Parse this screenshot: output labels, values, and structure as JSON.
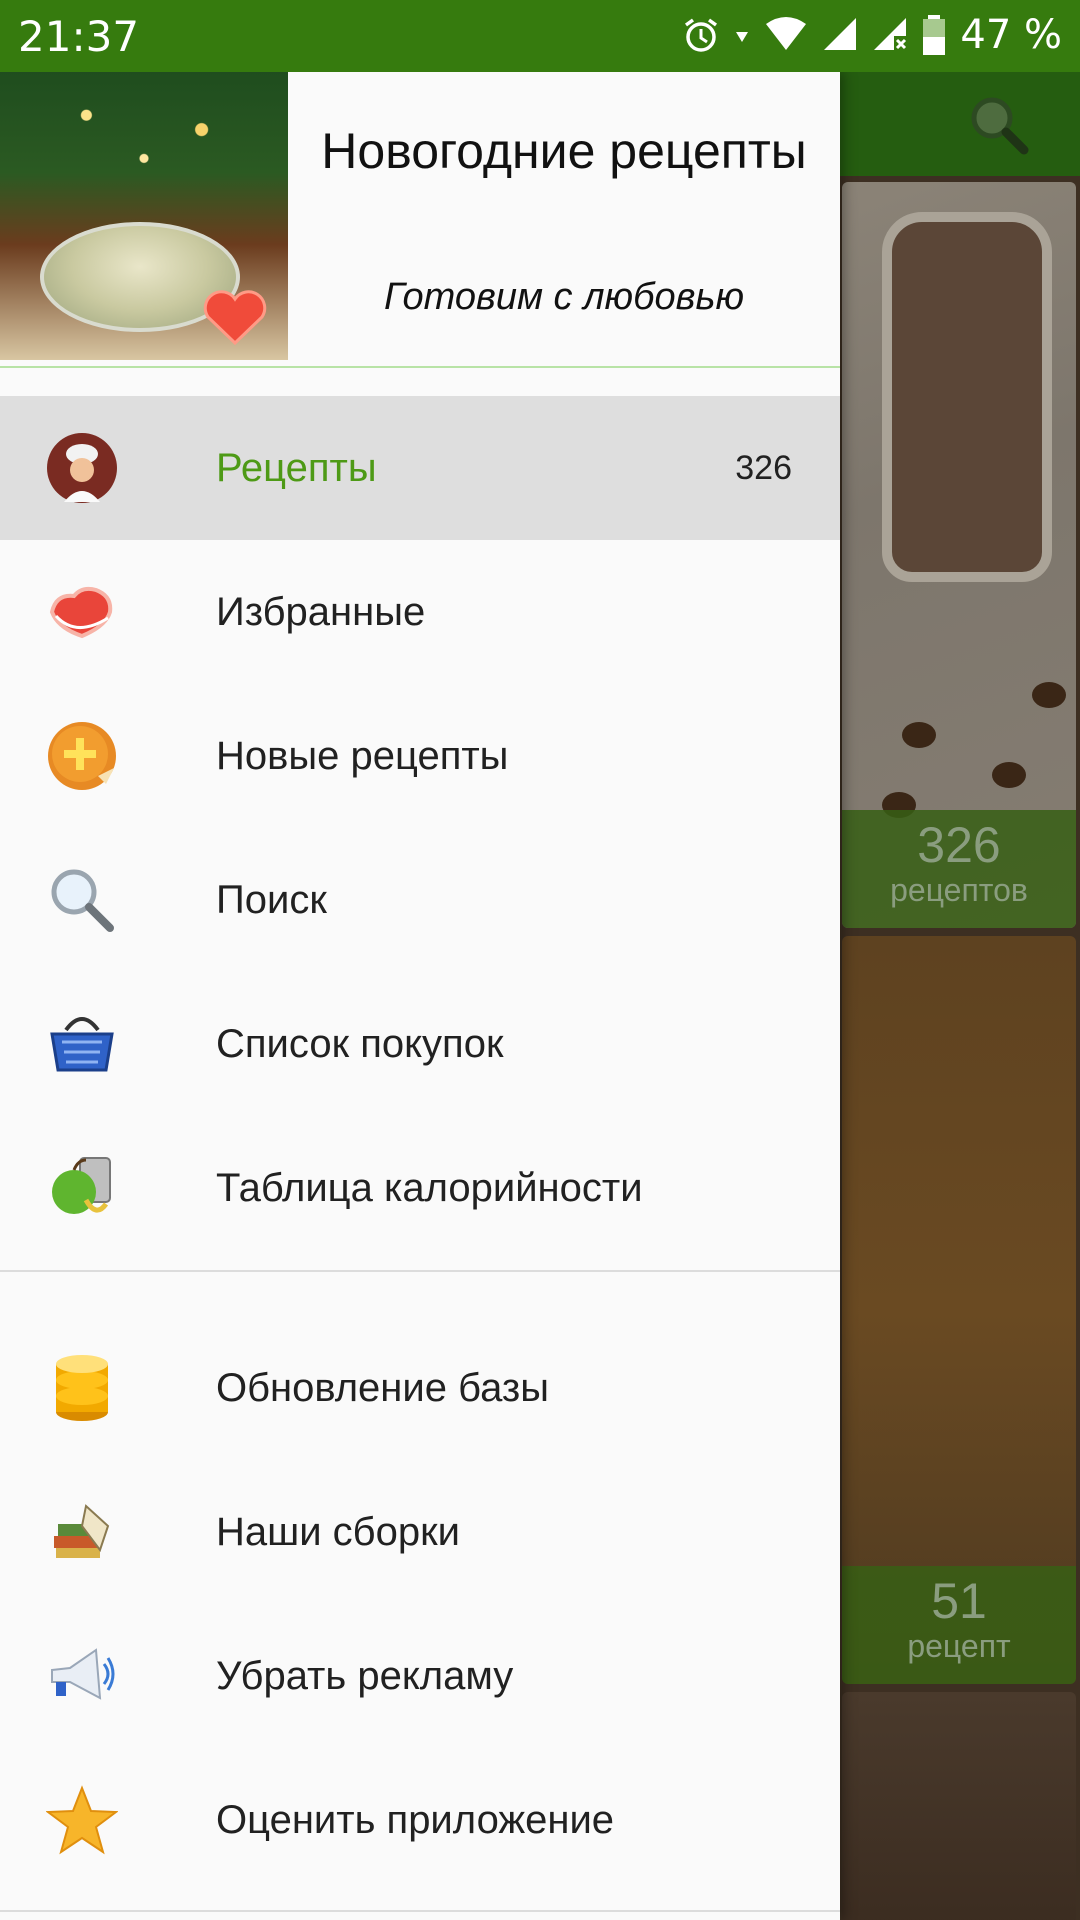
{
  "status_bar": {
    "time": "21:37",
    "battery": "47 %",
    "icons": [
      "alarm-icon",
      "data-arrow-icon",
      "wifi-icon",
      "signal-icon",
      "signal-noservice-icon",
      "battery-icon"
    ]
  },
  "background": {
    "cards": [
      {
        "count": "326",
        "word": "рецептов"
      },
      {
        "count": "51",
        "word": "рецепт"
      }
    ]
  },
  "drawer": {
    "header": {
      "title": "Новогодние рецепты",
      "subtitle": "Готовим с любовью"
    },
    "items": [
      {
        "label": "Рецепты",
        "count": "326",
        "icon": "chef-icon",
        "active": true
      },
      {
        "label": "Избранные",
        "icon": "heart-icon"
      },
      {
        "label": "Новые рецепты",
        "icon": "plus-badge-icon"
      },
      {
        "label": "Поиск",
        "icon": "magnifier-icon"
      },
      {
        "label": "Список покупок",
        "icon": "basket-icon"
      },
      {
        "label": "Таблица калорийности",
        "icon": "apple-calculator-icon"
      }
    ],
    "items2": [
      {
        "label": "Обновление базы",
        "icon": "database-icon"
      },
      {
        "label": "Наши сборки",
        "icon": "books-icon"
      },
      {
        "label": "Убрать рекламу",
        "icon": "megaphone-icon"
      },
      {
        "label": "Оценить приложение",
        "icon": "star-icon"
      }
    ]
  },
  "colors": {
    "status_bar": "#367b0e",
    "active_text": "#4e9a16",
    "active_bg": "#dedede",
    "divider": "#b8e3a6"
  }
}
